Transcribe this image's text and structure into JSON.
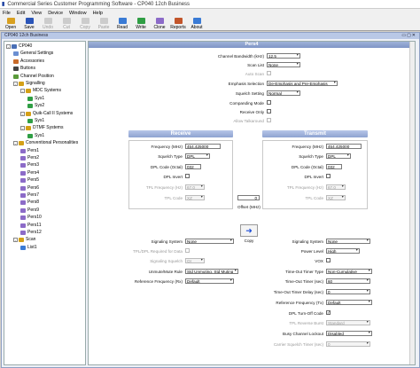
{
  "window": {
    "title": "Commercial Series Customer Programming Software - CP040 12ch Business"
  },
  "menu": [
    "File",
    "Edit",
    "View",
    "Device",
    "Window",
    "Help"
  ],
  "toolbar": [
    {
      "label": "Open",
      "icon": "open-folder-icon",
      "color": "#d8a020",
      "enabled": true
    },
    {
      "label": "Save",
      "icon": "save-disk-icon",
      "color": "#2a55b8",
      "enabled": true
    },
    {
      "label": "Undo",
      "icon": "undo-icon",
      "color": "#999",
      "enabled": false
    },
    {
      "label": "Cut",
      "icon": "cut-icon",
      "color": "#999",
      "enabled": false
    },
    {
      "label": "Copy",
      "icon": "copy-icon",
      "color": "#999",
      "enabled": false
    },
    {
      "label": "Paste",
      "icon": "paste-icon",
      "color": "#999",
      "enabled": false
    },
    {
      "label": "Read",
      "icon": "read-radio-icon",
      "color": "#3a7bd5",
      "enabled": true
    },
    {
      "label": "Write",
      "icon": "write-radio-icon",
      "color": "#2f9e44",
      "enabled": true
    },
    {
      "label": "Clone",
      "icon": "clone-icon",
      "color": "#8c6bc8",
      "enabled": true
    },
    {
      "label": "Reports",
      "icon": "reports-icon",
      "color": "#c2552a",
      "enabled": true
    },
    {
      "label": "About",
      "icon": "about-icon",
      "color": "#3a7bd5",
      "enabled": true
    }
  ],
  "frame": {
    "title": "CP040 12ch Business"
  },
  "tree": [
    {
      "label": "CP040",
      "level": 0,
      "exp": "-",
      "color": "#4a6fb5"
    },
    {
      "label": "General Settings",
      "level": 1,
      "exp": "",
      "color": "#6b8fd1"
    },
    {
      "label": "Accessories",
      "level": 1,
      "exp": "",
      "color": "#c86b2a"
    },
    {
      "label": "Buttons",
      "level": 1,
      "exp": "",
      "color": "#444"
    },
    {
      "label": "Channel Position",
      "level": 1,
      "exp": "",
      "color": "#5a9a3a"
    },
    {
      "label": "Signalling",
      "level": 1,
      "exp": "-",
      "color": "#d4a017"
    },
    {
      "label": "MDC Systems",
      "level": 2,
      "exp": "-",
      "color": "#d4a017"
    },
    {
      "label": "Sys1",
      "level": 3,
      "exp": "",
      "color": "#2f9e44"
    },
    {
      "label": "Sys2",
      "level": 3,
      "exp": "",
      "color": "#2f9e44"
    },
    {
      "label": "Quik-Call II Systems",
      "level": 2,
      "exp": "-",
      "color": "#d4a017"
    },
    {
      "label": "Sys1",
      "level": 3,
      "exp": "",
      "color": "#2f9e44"
    },
    {
      "label": "DTMF Systems",
      "level": 2,
      "exp": "-",
      "color": "#d4a017"
    },
    {
      "label": "Sys1",
      "level": 3,
      "exp": "",
      "color": "#2f9e44"
    },
    {
      "label": "Conventional Personalities",
      "level": 1,
      "exp": "-",
      "color": "#d4a017"
    },
    {
      "label": "Pers1",
      "level": 2,
      "exp": "",
      "color": "#8c6bc8"
    },
    {
      "label": "Pers2",
      "level": 2,
      "exp": "",
      "color": "#8c6bc8"
    },
    {
      "label": "Pers3",
      "level": 2,
      "exp": "",
      "color": "#8c6bc8"
    },
    {
      "label": "Pers4",
      "level": 2,
      "exp": "",
      "color": "#8c6bc8"
    },
    {
      "label": "Pers5",
      "level": 2,
      "exp": "",
      "color": "#8c6bc8"
    },
    {
      "label": "Pers6",
      "level": 2,
      "exp": "",
      "color": "#8c6bc8"
    },
    {
      "label": "Pers7",
      "level": 2,
      "exp": "",
      "color": "#8c6bc8"
    },
    {
      "label": "Pers8",
      "level": 2,
      "exp": "",
      "color": "#8c6bc8"
    },
    {
      "label": "Pers9",
      "level": 2,
      "exp": "",
      "color": "#8c6bc8"
    },
    {
      "label": "Pers10",
      "level": 2,
      "exp": "",
      "color": "#8c6bc8"
    },
    {
      "label": "Pers11",
      "level": 2,
      "exp": "",
      "color": "#8c6bc8"
    },
    {
      "label": "Pers12",
      "level": 2,
      "exp": "",
      "color": "#8c6bc8"
    },
    {
      "label": "Scan",
      "level": 1,
      "exp": "-",
      "color": "#d4a017"
    },
    {
      "label": "List1",
      "level": 2,
      "exp": "",
      "color": "#3a7bd5"
    }
  ],
  "panel": {
    "header": "Pers4",
    "top": {
      "channel_bandwidth": {
        "label": "Channel Bandwidth (kHz)",
        "value": "12.5"
      },
      "scan_list": {
        "label": "Scan List",
        "value": "None"
      },
      "auto_scan": {
        "label": "Auto Scan"
      },
      "emphasis": {
        "label": "Emphasis Selection",
        "value": "De-Emphasis and Pre-Emphasis"
      },
      "squelch": {
        "label": "Squelch Setting",
        "value": "Normal"
      },
      "companding": {
        "label": "Companding Mode"
      },
      "receive_only": {
        "label": "Receive Only"
      },
      "talkaround": {
        "label": "Allow Talkaround"
      }
    },
    "receive": {
      "title": "Receive",
      "frequency": {
        "label": "Frequency (MHz)",
        "value": "454.425000"
      },
      "squelch_type": {
        "label": "Squelch Type",
        "value": "DPL"
      },
      "dpl_code": {
        "label": "DPL Code (Octal)",
        "value": "032"
      },
      "dpl_invert": {
        "label": "DPL Invert"
      },
      "tpl_freq": {
        "label": "TPL Frequency (Hz)",
        "value": "67.0"
      },
      "tpl_code": {
        "label": "TPL Code",
        "value": "XZ"
      }
    },
    "middle": {
      "offset_value": "0",
      "offset_label": "Offset (MHz)",
      "copy_label": "Copy"
    },
    "transmit": {
      "title": "Transmit",
      "frequency": {
        "label": "Frequency (MHz)",
        "value": "454.425000"
      },
      "squelch_type": {
        "label": "Squelch Type",
        "value": "DPL"
      },
      "dpl_code": {
        "label": "DPL Code (Octal)",
        "value": "032"
      },
      "dpl_invert": {
        "label": "DPL Invert"
      },
      "tpl_freq": {
        "label": "TPL Frequency (Hz)",
        "value": "67.0"
      },
      "tpl_code": {
        "label": "TPL Code",
        "value": "XZ"
      }
    },
    "rx_lower": {
      "signaling_system": {
        "label": "Signaling System",
        "value": "None"
      },
      "tpl_required": {
        "label": "TPL/DPL Required for Data"
      },
      "signaling_squelch": {
        "label": "Signaling Squelch",
        "value": "Or"
      },
      "unmute_rule": {
        "label": "Unmute/Mute Rule",
        "value": "Std Unmuting, Std Muting"
      },
      "ref_freq": {
        "label": "Reference Frequency (Rx)",
        "value": "Default"
      }
    },
    "tx_lower": {
      "signaling_system": {
        "label": "Signaling System",
        "value": "None"
      },
      "power_level": {
        "label": "Power Level",
        "value": "High"
      },
      "vox": {
        "label": "VOX"
      },
      "tot_type": {
        "label": "Time-Out Timer Type",
        "value": "Non-Cumulative"
      },
      "tot": {
        "label": "Time-Out Timer (sec)",
        "value": "60"
      },
      "tot_delay": {
        "label": "Time-Out Timer Delay (sec)",
        "value": "0"
      },
      "ref_freq": {
        "label": "Reference Frequency (Tx)",
        "value": "Default"
      },
      "dpl_turnoff": {
        "label": "DPL Turn-Off Code"
      },
      "tpl_reverse": {
        "label": "TPL Reverse Burst",
        "value": "Standard"
      },
      "bcl": {
        "label": "Busy Channel Lockout",
        "value": "Disabled"
      },
      "carrier_squelch_timer": {
        "label": "Carrier Squelch Timer (sec)",
        "value": "0"
      }
    }
  }
}
